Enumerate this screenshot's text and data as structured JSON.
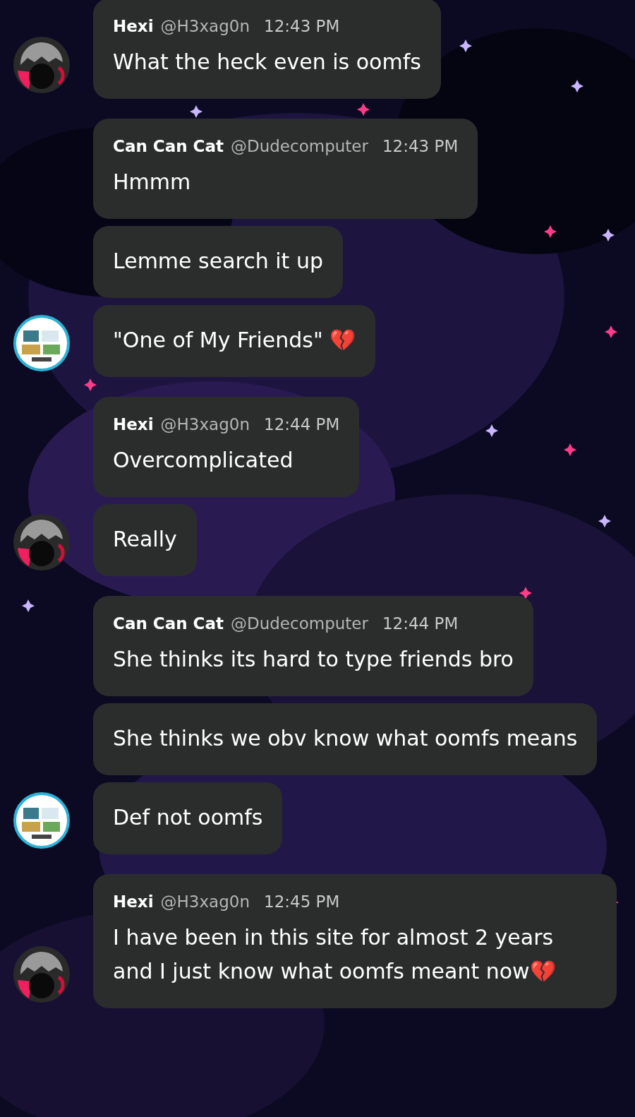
{
  "messages": [
    {
      "header": {
        "name": "Hexi",
        "handle": "@H3xag0n",
        "time": "12:43 PM"
      },
      "text": "What the heck even is oomfs",
      "avatar": {
        "kind": "hexi"
      }
    },
    {
      "header": {
        "name": "Can Can Cat",
        "handle": "@Dudecomputer",
        "time": "12:43 PM"
      },
      "text": "Hmmm"
    },
    {
      "text": "Lemme search it up"
    },
    {
      "text": "\"One of My Friends\" 💔",
      "avatar": {
        "kind": "cat"
      }
    },
    {
      "header": {
        "name": "Hexi",
        "handle": "@H3xag0n",
        "time": "12:44 PM"
      },
      "text": "Overcomplicated"
    },
    {
      "text": "Really",
      "avatar": {
        "kind": "hexi"
      }
    },
    {
      "header": {
        "name": "Can Can Cat",
        "handle": "@Dudecomputer",
        "time": "12:44 PM"
      },
      "text": "She thinks its hard to type friends bro"
    },
    {
      "text": "She thinks we obv know what oomfs means"
    },
    {
      "text": "Def not oomfs",
      "avatar": {
        "kind": "cat"
      }
    },
    {
      "header": {
        "name": "Hexi",
        "handle": "@H3xag0n",
        "time": "12:45 PM"
      },
      "text": "I have been in this site for almost 2 years and I just know what oomfs meant now💔",
      "avatar": {
        "kind": "hexi"
      }
    }
  ]
}
